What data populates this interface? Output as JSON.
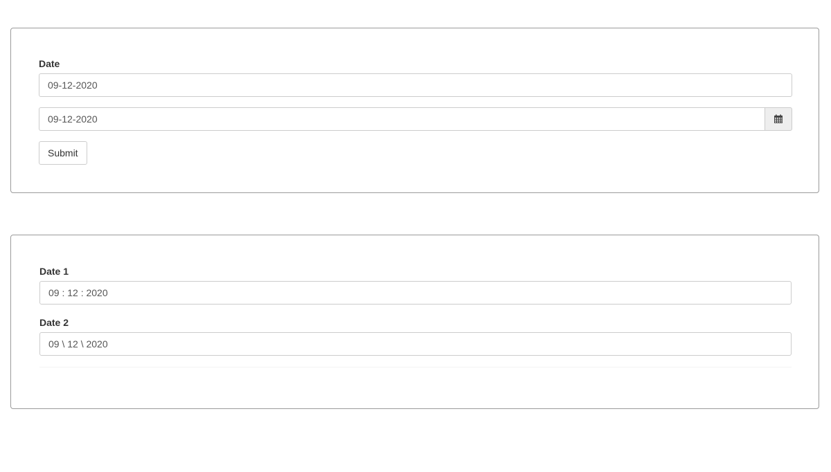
{
  "form1": {
    "date_label": "Date",
    "date_value": "09-12-2020",
    "datepicker_value": "09-12-2020",
    "calendar_icon": "calendar-icon",
    "submit_label": "Submit"
  },
  "form2": {
    "date1_label": "Date 1",
    "date1_value": "09 : 12 : 2020",
    "date2_label": "Date 2",
    "date2_value": "09 \\ 12 \\ 2020"
  }
}
